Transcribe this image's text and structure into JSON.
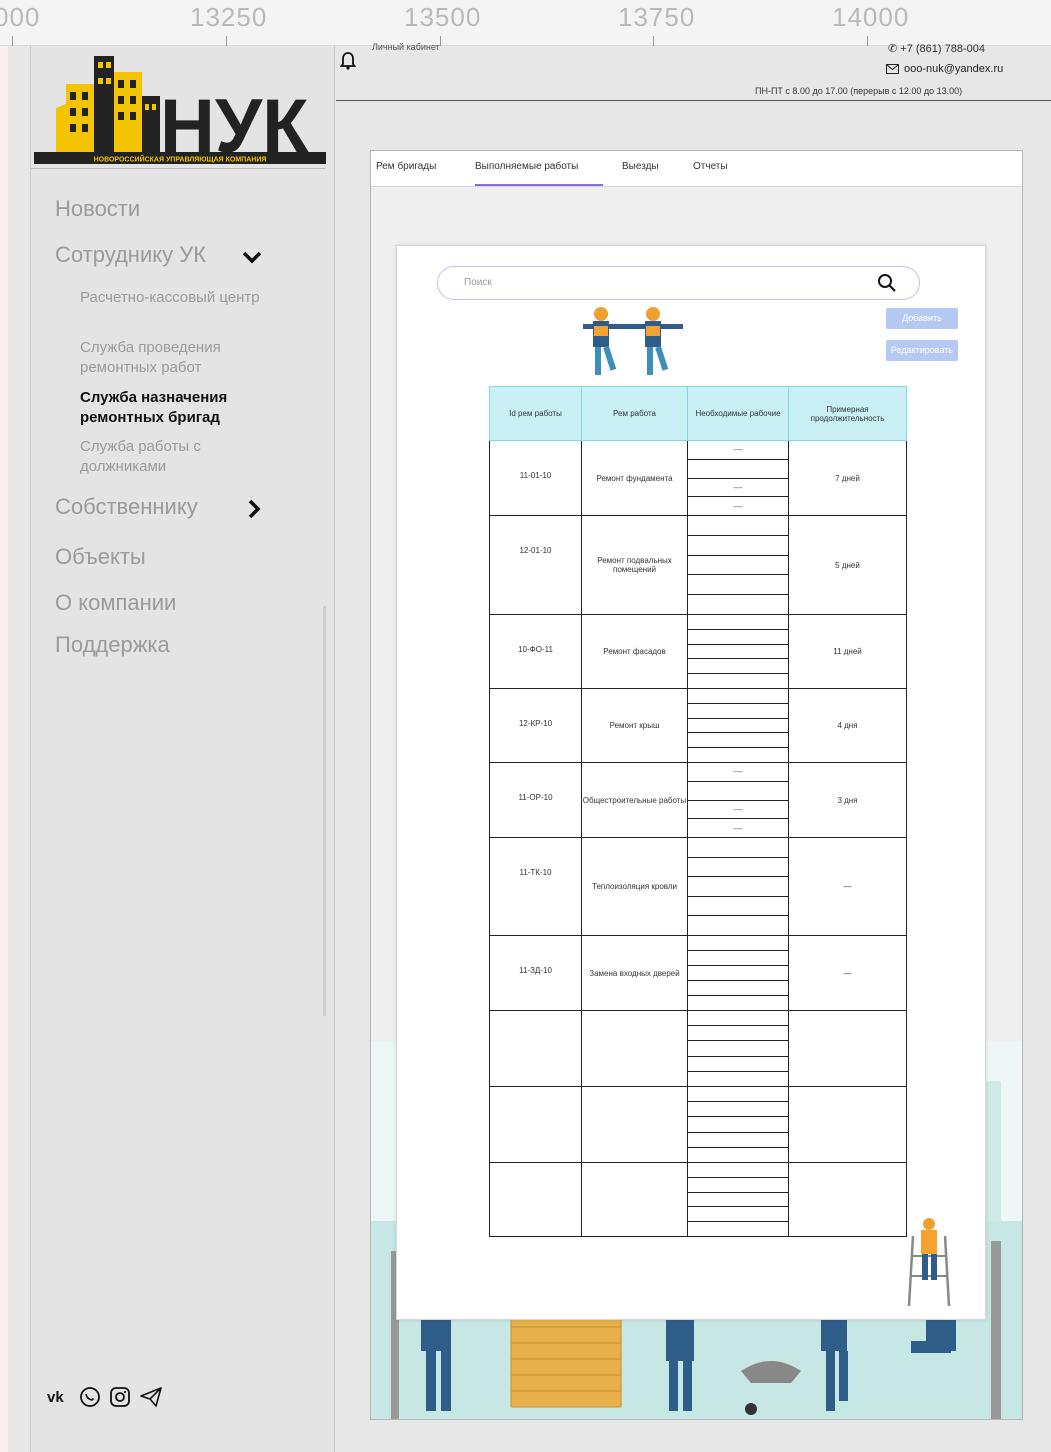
{
  "ruler": {
    "labels": [
      "000",
      "13250",
      "13500",
      "13750",
      "14000"
    ]
  },
  "sidebar": {
    "logo_text": "НУК",
    "logo_subtitle": "НОВОРОССИЙСКАЯ УПРАВЛЯЮЩАЯ КОМПАНИЯ",
    "nav": [
      {
        "label": "Новости"
      },
      {
        "label": "Сотруднику УК"
      },
      {
        "label": "Собственнику"
      },
      {
        "label": "Объекты"
      },
      {
        "label": "О компании"
      },
      {
        "label": "Поддержка"
      }
    ],
    "sub": [
      {
        "label": "Расчетно-кассовый центр"
      },
      {
        "label": "Служба проведения ремонтных работ"
      },
      {
        "label": "Служба назначения ремонтных бригад"
      },
      {
        "label": "Служба работы с должниками"
      }
    ],
    "social_icons": [
      "vk-icon",
      "whatsapp-icon",
      "instagram-icon",
      "telegram-icon"
    ]
  },
  "header": {
    "cabinet": "Личный кабинет",
    "phone": "+7 (861) 788-004",
    "email": "ooo-nuk@yandex.ru",
    "hours": "ПН-ПТ с 8.00 до 17.00 (перерыв с 12.00 до 13.00)"
  },
  "tabs": [
    {
      "label": "Рем бригады"
    },
    {
      "label": "Выполняемые работы"
    },
    {
      "label": "Выезды"
    },
    {
      "label": "Отчеты"
    }
  ],
  "search": {
    "placeholder": "Поиск"
  },
  "buttons": {
    "add": "Добавить",
    "edit": "Редактировать"
  },
  "table": {
    "headers": [
      "Id рем работы",
      "Рем работа",
      "Необходимые рабочие",
      "Примерная продолжительность"
    ],
    "rows": [
      {
        "id": "11-01-10",
        "work": "Ремонт фундамента",
        "duration": "7 дней",
        "sub": [
          "—",
          "",
          "—",
          "—"
        ]
      },
      {
        "id": "12-01-10",
        "work": "Ремонт подвальных помещений",
        "duration": "5 дней",
        "sub": [
          "",
          "",
          "",
          "",
          ""
        ]
      },
      {
        "id": "10-ФО-11",
        "work": "Ремонт фасадов",
        "duration": "11 дней",
        "sub": [
          "",
          "",
          "",
          "",
          ""
        ]
      },
      {
        "id": "12-КР-10",
        "work": "Ремонт крыш",
        "duration": "4 дня",
        "sub": [
          "",
          "",
          "",
          "",
          ""
        ]
      },
      {
        "id": "11-ОР-10",
        "work": "Общестроительные работы",
        "duration": "3 дня",
        "sub": [
          "—",
          "",
          "—",
          "—"
        ]
      },
      {
        "id": "11-ТК-10",
        "work": "Теплоизоляция кровли",
        "duration": "—",
        "sub": [
          "",
          "",
          "",
          "",
          ""
        ]
      },
      {
        "id": "11-ЗД-10",
        "work": "Замена входных дверей",
        "duration": "—",
        "sub": [
          "",
          "",
          "",
          "",
          ""
        ]
      },
      {
        "id": "",
        "work": "",
        "duration": "",
        "sub": [
          "",
          "",
          "",
          "",
          ""
        ]
      },
      {
        "id": "",
        "work": "",
        "duration": "",
        "sub": [
          "",
          "",
          "",
          "",
          ""
        ]
      },
      {
        "id": "",
        "work": "",
        "duration": "",
        "sub": [
          "",
          "",
          "",
          "",
          ""
        ]
      }
    ]
  }
}
